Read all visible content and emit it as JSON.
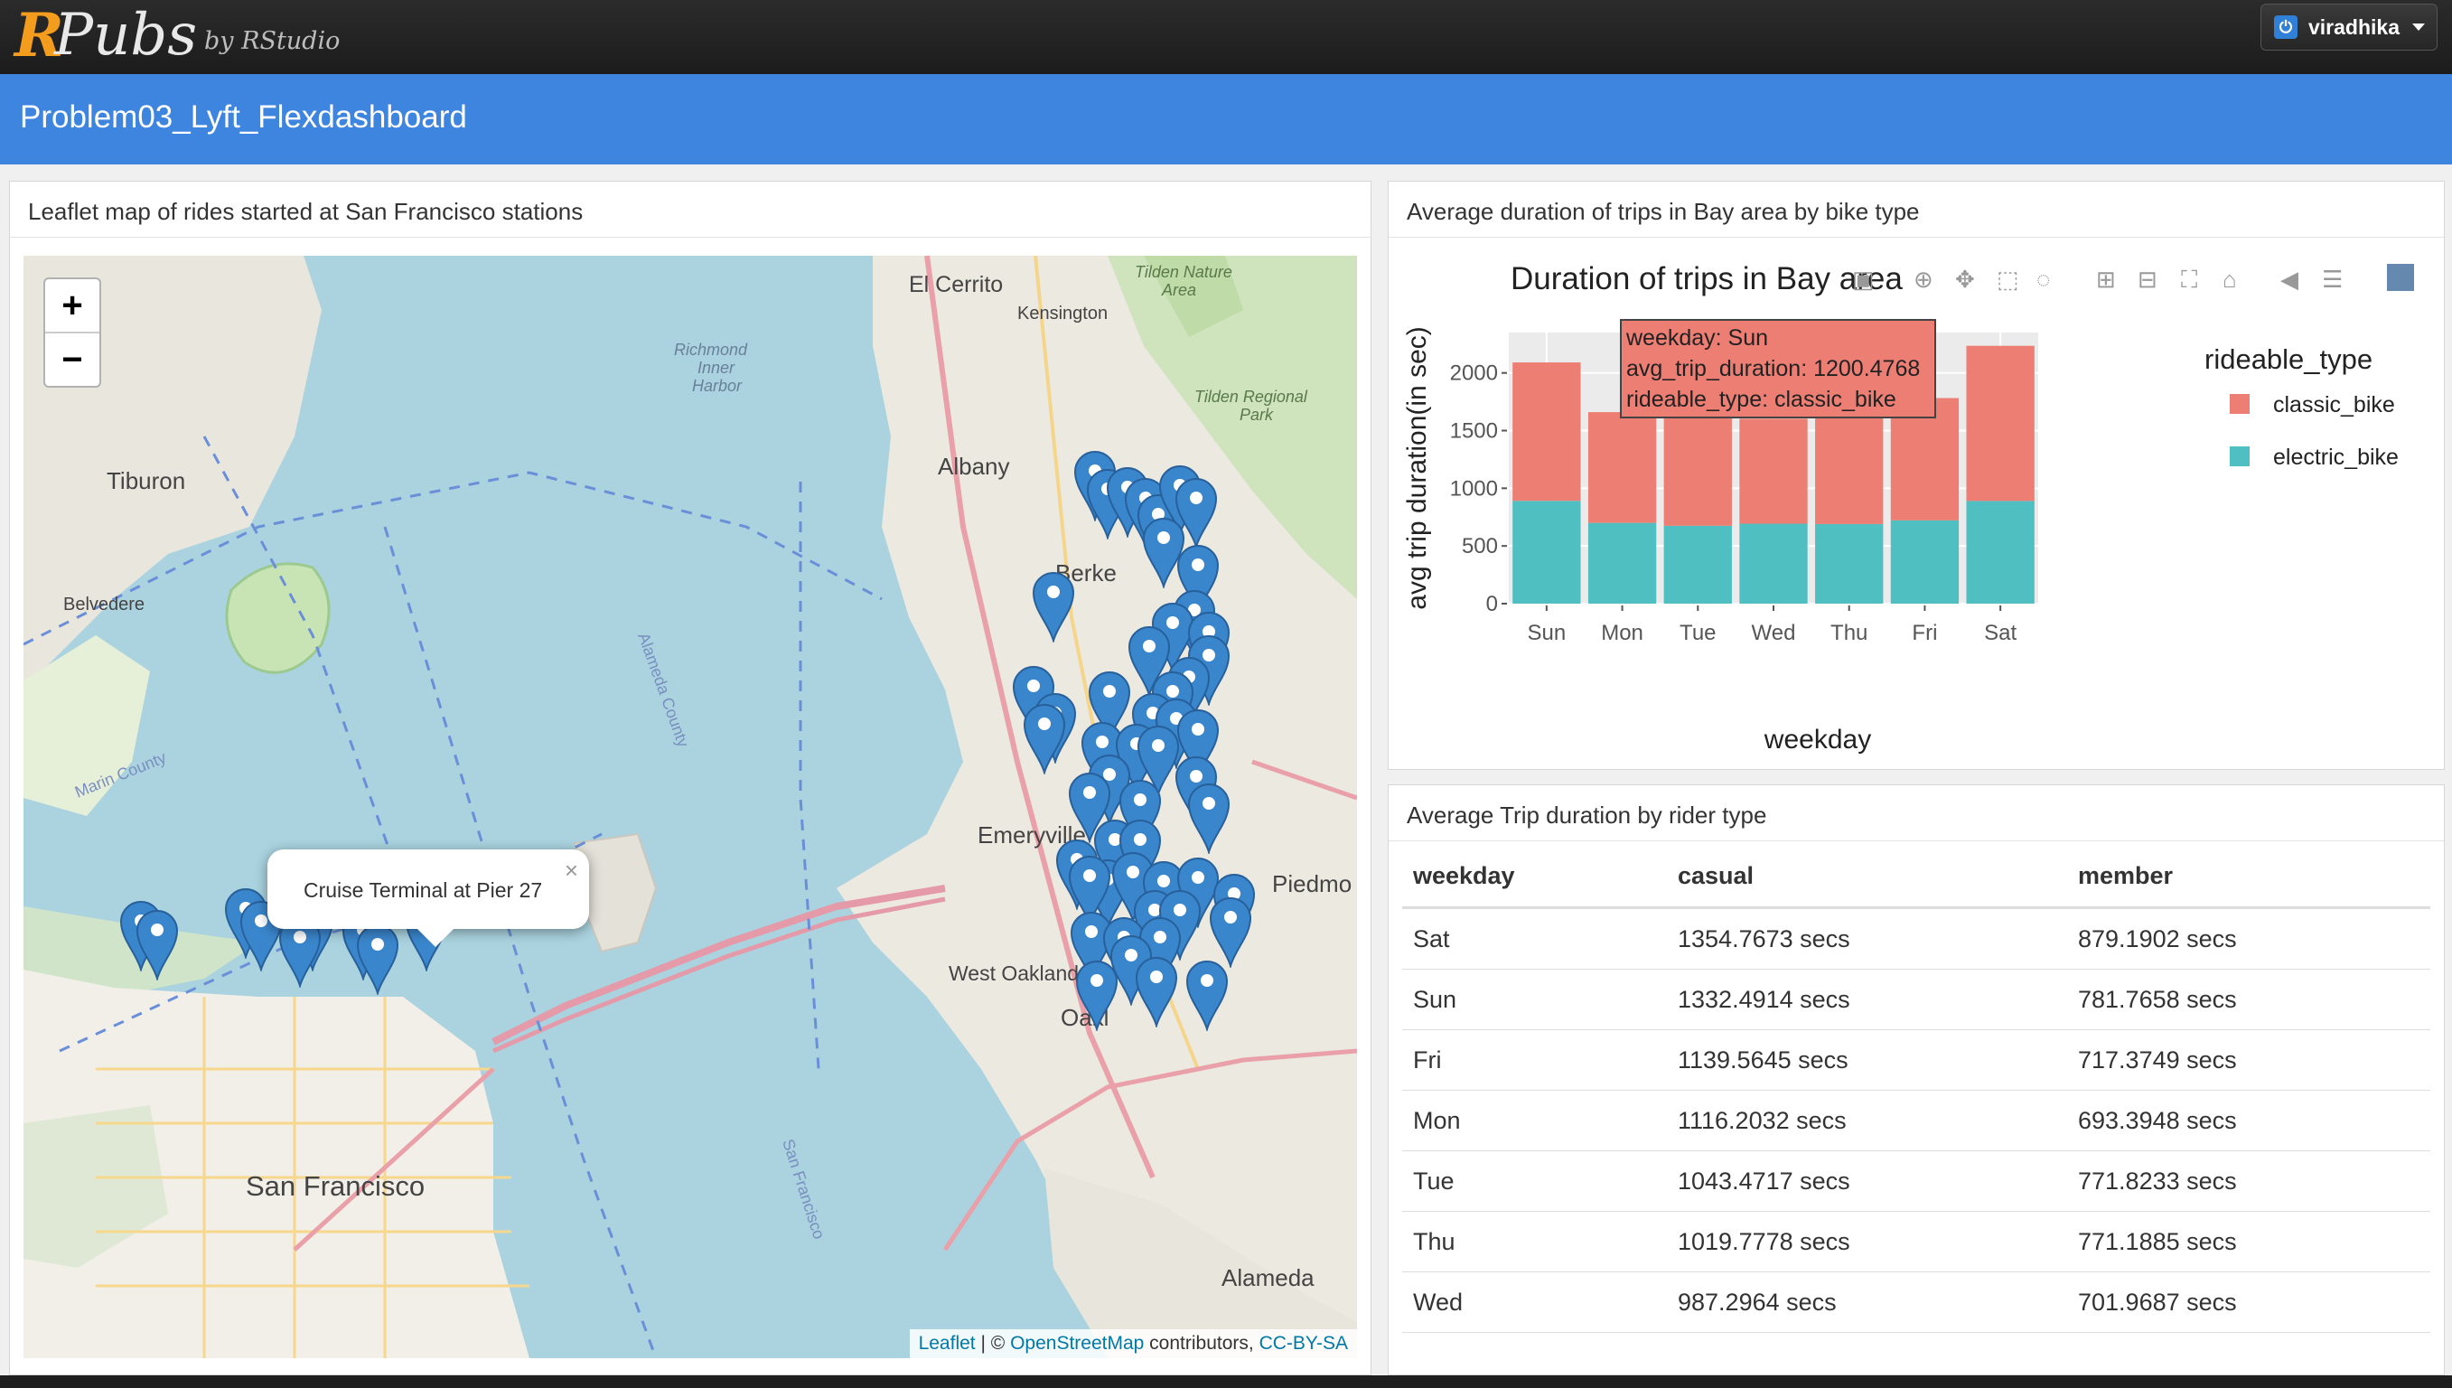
{
  "brand": {
    "r": "R",
    "pubs": "Pubs",
    "by": "by RStudio"
  },
  "user": {
    "name": "viradhika"
  },
  "page_title": "Problem03_Lyft_Flexdashboard",
  "map_panel": {
    "title": "Leaflet map of rides started at San Francisco stations",
    "zoom_in": "+",
    "zoom_out": "−",
    "popup": "Cruise Terminal at Pier 27",
    "popup_close": "×",
    "attribution": {
      "leaflet": "Leaflet",
      "sep": " | © ",
      "osm": "OpenStreetMap",
      "contrib": " contributors, ",
      "license": "CC-BY-SA"
    },
    "place_labels": [
      "El Cerrito",
      "Kensington",
      "Tilden Nature Area",
      "Richmond Inner Harbor",
      "Tilden Regional Park",
      "Tiburon",
      "Albany",
      "Belvedere",
      "Berke",
      "Emeryville",
      "Piedmo",
      "West Oakland",
      "Oakl",
      "San Francisco",
      "Alameda",
      "Marin County",
      "Alameda County",
      "San Francisco"
    ]
  },
  "chart_panel": {
    "title": "Average duration of trips in Bay area by bike type",
    "tooltip": [
      "weekday: Sun",
      "avg_trip_duration: 1200.4768",
      "rideable_type: classic_bike"
    ]
  },
  "chart_data": {
    "type": "bar",
    "stacked": true,
    "title": "Duration of trips in Bay area",
    "xlabel": "weekday",
    "ylabel": "avg trip duration(in sec)",
    "categories": [
      "Sun",
      "Mon",
      "Tue",
      "Wed",
      "Thu",
      "Fri",
      "Sat"
    ],
    "ylim": [
      0,
      2350
    ],
    "yticks": [
      0,
      500,
      1000,
      1500,
      2000
    ],
    "legend_title": "rideable_type",
    "legend_position": "right",
    "series": [
      {
        "name": "electric_bike",
        "color": "#4fbfc2",
        "values": [
          891,
          700,
          675,
          693,
          690,
          722,
          890
        ]
      },
      {
        "name": "classic_bike",
        "color": "#ec7e74",
        "values": [
          1200,
          960,
          1055,
          910,
          1037,
          1060,
          1345
        ]
      }
    ]
  },
  "table_panel": {
    "title": "Average Trip duration by rider type",
    "headers": [
      "weekday",
      "casual",
      "member"
    ],
    "rows": [
      [
        "Sat",
        "1354.7673 secs",
        "879.1902 secs"
      ],
      [
        "Sun",
        "1332.4914 secs",
        "781.7658 secs"
      ],
      [
        "Fri",
        "1139.5645 secs",
        "717.3749 secs"
      ],
      [
        "Mon",
        "1116.2032 secs",
        "693.3948 secs"
      ],
      [
        "Tue",
        "1043.4717 secs",
        "771.8233 secs"
      ],
      [
        "Thu",
        "1019.7778 secs",
        "771.1885 secs"
      ],
      [
        "Wed",
        "987.2964 secs",
        "701.9687 secs"
      ]
    ]
  }
}
